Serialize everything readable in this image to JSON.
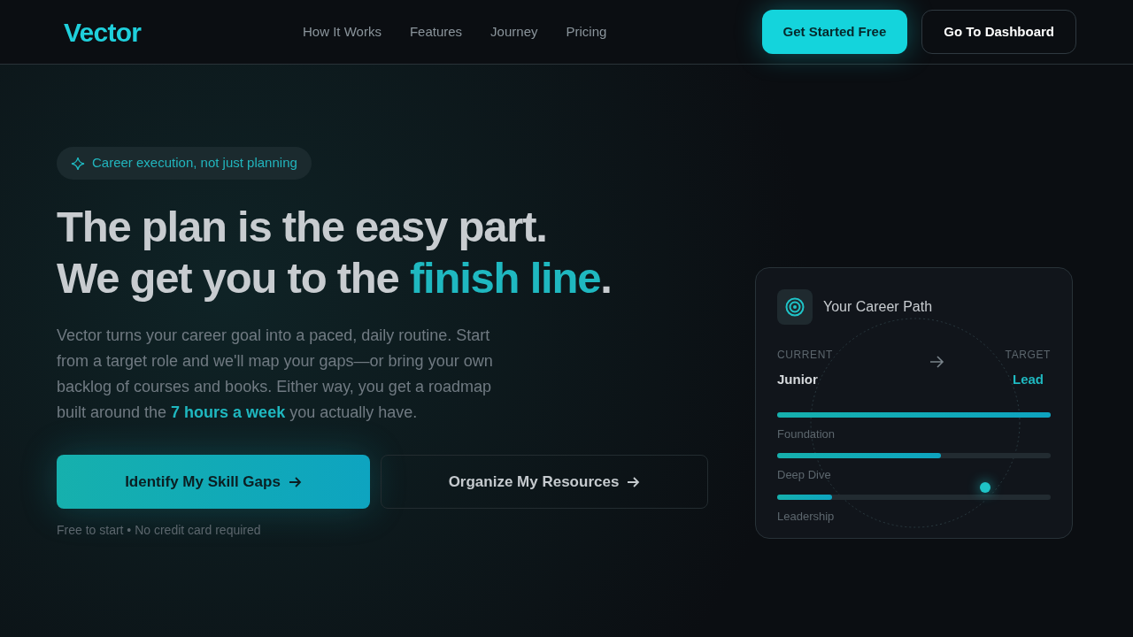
{
  "header": {
    "logo": "Vector",
    "nav": [
      "How It Works",
      "Features",
      "Journey",
      "Pricing"
    ],
    "primary_button": "Get Started Free",
    "secondary_button": "Go To Dashboard"
  },
  "hero": {
    "badge": "Career execution, not just planning",
    "headline": [
      [
        {
          "text": "The plan is the easy part.",
          "highlight": false
        }
      ],
      [
        {
          "text": "We get you to the ",
          "highlight": false
        },
        {
          "text": "finish line",
          "highlight": true
        },
        {
          "text": ".",
          "highlight": false
        }
      ]
    ],
    "description": "Vector turns your career goal into a paced, daily routine. Start from a target role and we'll map your gaps—or bring your own backlog of courses and books. Either way, you get a roadmap built around the **7 hours a week** you actually have.",
    "primary_cta": "Identify My Skill Gaps",
    "secondary_cta": "Organize My Resources",
    "note": "Free to start • No credit card required"
  },
  "career_card": {
    "title": "Your Career Path",
    "current_label": "CURRENT",
    "current_value": "Junior",
    "target_label": "TARGET",
    "target_value": "Lead",
    "stages": [
      {
        "name": "Foundation",
        "level": 1.0
      },
      {
        "name": "Deep Dive",
        "level": 0.6
      },
      {
        "name": "Leadership",
        "level": 0.2
      }
    ]
  }
}
